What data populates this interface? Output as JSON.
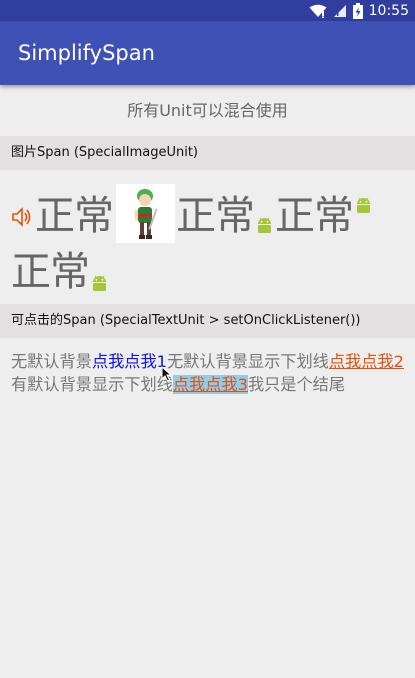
{
  "status_bar": {
    "time": "10:55",
    "icons": [
      "wifi-icon",
      "signal-icon",
      "battery-charging-icon"
    ]
  },
  "app_bar": {
    "title": "SimplifySpan"
  },
  "caption": "所有Unit可以混合使用",
  "sections": {
    "image_span_header": "图片Span (SpecialImageUnit)",
    "clickable_span_header": "可点击的Span (SpecialTextUnit > setOnClickListener())"
  },
  "image_span": {
    "word": "正常"
  },
  "clickable_text": {
    "part1": "无默认背景",
    "link1": "点我点我1",
    "part2": "无默认背景显示下划线",
    "link2": "点我点我2",
    "part3": "有默认背景显示下划线",
    "link3": "点我点我3",
    "part4": "我只是个结尾"
  },
  "colors": {
    "status_bar": "#303F9F",
    "app_bar": "#3F51B5",
    "link_blue": "#1010E0",
    "link_orange": "#E5520A",
    "link_bg": "#8FCDEF",
    "android_green": "#A4C639"
  }
}
